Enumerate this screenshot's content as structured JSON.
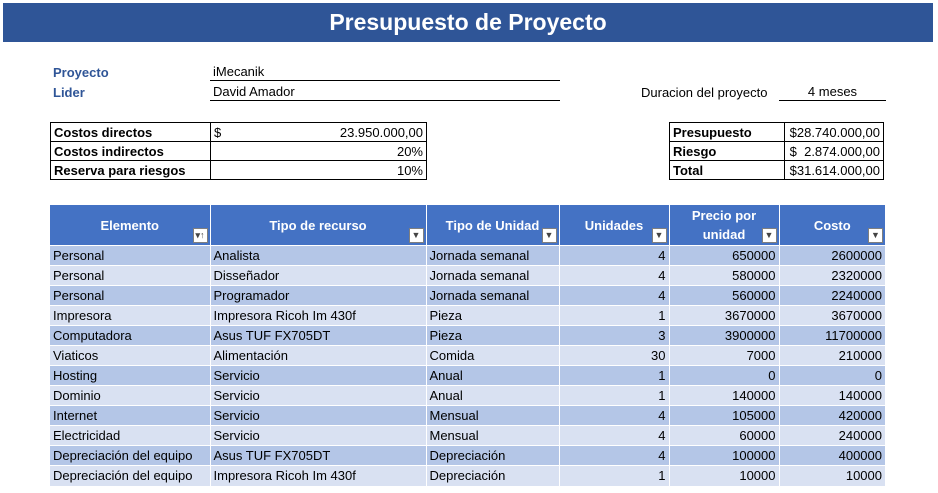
{
  "title": "Presupuesto de Proyecto",
  "project": {
    "proyecto_label": "Proyecto",
    "proyecto_value": "iMecanik",
    "lider_label": "Lider",
    "lider_value": "David Amador",
    "duracion_label": "Duracion del proyecto",
    "duracion_value": "4 meses"
  },
  "costs": {
    "directos_label": "Costos directos",
    "directos_currency": "$",
    "directos_value": "23.950.000,00",
    "indirectos_label": "Costos indirectos",
    "indirectos_value": "20%",
    "reserva_label": "Reserva para riesgos",
    "reserva_value": "10%"
  },
  "summary": {
    "presupuesto_label": "Presupuesto",
    "presupuesto_value": "$28.740.000,00",
    "riesgo_label": "Riesgo",
    "riesgo_value": "$  2.874.000,00",
    "total_label": "Total",
    "total_value": "$31.614.000,00"
  },
  "table": {
    "headers": [
      "Elemento",
      "Tipo de recurso",
      "Tipo de Unidad",
      "Unidades",
      "Precio por unidad",
      "Costo"
    ],
    "filter_icons": [
      "sort-filter-icon",
      "dropdown-arrow-icon",
      "dropdown-arrow-icon",
      "dropdown-arrow-icon",
      "dropdown-arrow-icon",
      "dropdown-arrow-icon"
    ],
    "rows": [
      [
        "Personal",
        "Analista",
        "Jornada semanal",
        "4",
        "650000",
        "2600000"
      ],
      [
        "Personal",
        "Disseñador",
        "Jornada semanal",
        "4",
        "580000",
        "2320000"
      ],
      [
        "Personal",
        "Programador",
        "Jornada semanal",
        "4",
        "560000",
        "2240000"
      ],
      [
        "Impresora",
        "Impresora Ricoh Im 430f",
        "Pieza",
        "1",
        "3670000",
        "3670000"
      ],
      [
        "Computadora",
        "Asus TUF FX705DT",
        "Pieza",
        "3",
        "3900000",
        "11700000"
      ],
      [
        "Viaticos",
        "Alimentación",
        "Comida",
        "30",
        "7000",
        "210000"
      ],
      [
        "Hosting",
        "Servicio",
        "Anual",
        "1",
        "0",
        "0"
      ],
      [
        "Dominio",
        "Servicio",
        "Anual",
        "1",
        "140000",
        "140000"
      ],
      [
        "Internet",
        "Servicio",
        "Mensual",
        "4",
        "105000",
        "420000"
      ],
      [
        "Electricidad",
        "Servicio",
        "Mensual",
        "4",
        "60000",
        "240000"
      ],
      [
        "Depreciación del equipo",
        "Asus TUF FX705DT",
        "Depreciación",
        "4",
        "100000",
        "400000"
      ],
      [
        "Depreciación del equipo",
        "Impresora Ricoh Im 430f",
        "Depreciación",
        "1",
        "10000",
        "10000"
      ]
    ]
  },
  "colors": {
    "title_bg": "#2f5597",
    "header_bg": "#4472c4",
    "row_odd": "#b4c6e7",
    "row_even": "#d9e1f2",
    "label_color": "#2f5597"
  }
}
